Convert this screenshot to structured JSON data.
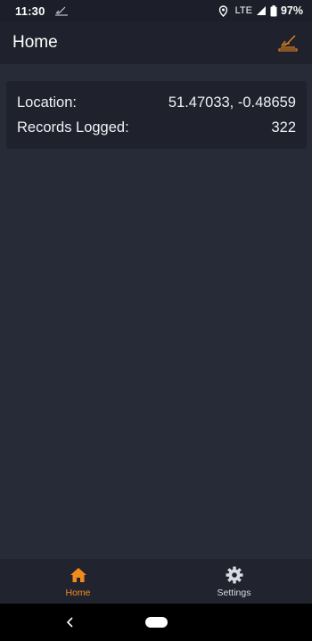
{
  "status_bar": {
    "time": "11:30",
    "network": "LTE",
    "battery": "97%",
    "icons": [
      "location-icon",
      "signal-icon",
      "battery-icon",
      "notification-icon"
    ]
  },
  "app_bar": {
    "title": "Home",
    "action_icon": "logging-icon",
    "accent_color": "#f28b1e"
  },
  "info_card": {
    "rows": [
      {
        "label": "Location:",
        "value": "51.47033, -0.48659"
      },
      {
        "label": "Records Logged:",
        "value": "322"
      }
    ]
  },
  "bottom_nav": {
    "items": [
      {
        "label": "Home",
        "icon": "home-icon",
        "active": true
      },
      {
        "label": "Settings",
        "icon": "gear-icon",
        "active": false
      }
    ],
    "active_color": "#f28b1e"
  },
  "system_nav": {
    "icons": [
      "back-icon",
      "home-pill"
    ]
  }
}
